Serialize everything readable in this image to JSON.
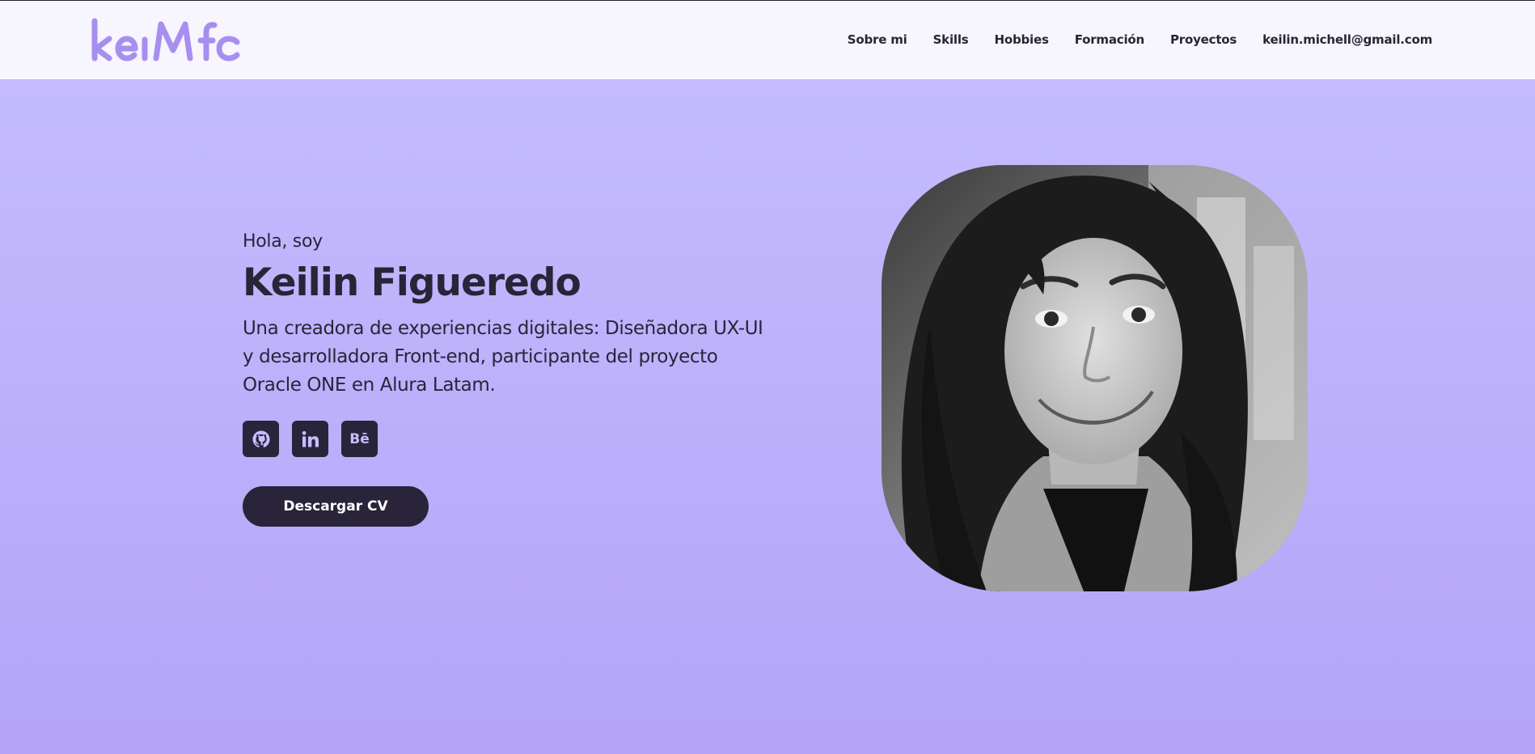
{
  "brand": {
    "logo_text": "keıMfc",
    "logo_color": "#a78ff0"
  },
  "nav": {
    "links": [
      "Sobre mi",
      "Skills",
      "Hobbies",
      "Formación",
      "Proyectos",
      "keilin.michell@gmail.com"
    ]
  },
  "hero": {
    "greeting": "Hola, soy",
    "name": "Keilin Figueredo",
    "tagline": "Una creadora de experiencias digitales: Diseñadora UX-UI y desarrolladora Front-end, participante del proyecto Oracle ONE en Alura Latam.",
    "socials": [
      {
        "icon": "github-icon",
        "label": "GitHub"
      },
      {
        "icon": "linkedin-icon",
        "label": "in"
      },
      {
        "icon": "behance-icon",
        "label": "Bē"
      }
    ],
    "cv_button": "Descargar CV"
  },
  "colors": {
    "accent_dark": "#29243a",
    "background_top": "#c7beff",
    "background_bottom": "#b3a4f7",
    "navbar": "#f7f5fd"
  }
}
